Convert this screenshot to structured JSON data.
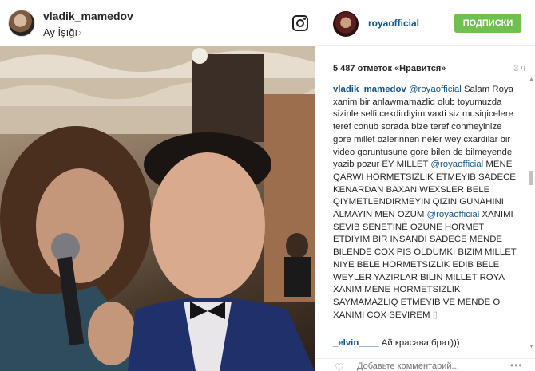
{
  "post": {
    "username": "vladik_mamedov",
    "location": "Ay İşığı",
    "location_chevron": "›"
  },
  "sidebar": {
    "account": "royaofficial",
    "follow_label": "ПОДПИСКИ",
    "likes": "5 487 отметок «Нравится»",
    "time": "3 ч"
  },
  "caption": {
    "user": "vladik_mamedov",
    "mention_1": "@royaofficial",
    "text_1": " Salam Roya xanim bir anlawmamazliq olub toyumuzda sizinle selfi cekdirdiyim vaxti siz musiqicelere teref conub sorada bize teref conmeyinize gore millet ozlerinnen neler wey cxardilar bir video goruntusune gore bilen de bilmeyende yazib pozur EY MILLET ",
    "mention_2": "@royaofficial",
    "text_2": " MENE QARWI HORMETSIZLIK ETMEYIB SADECE KENARDAN BAXAN WEXSLER BELE QIYMETLENDIRMEYIN QIZIN GUNAHINI ALMAYIN MEN OZUM ",
    "mention_3": "@royaofficial",
    "text_3": " XANIMI SEVIB SENETINE OZUNE HORMET ETDIYIM BIR INSANDI SADECE MENDE BILENDE COX PIS OLDUMKI BIZIM MILLET NIYE BELE HORMETSIZLIK EDIB BELE WEYLER YAZIRLAR BILIN MILLET ROYA XANIM MENE HORMETSIZLIK SAYMAMAZLIQ ETMEYIB VE MENDE O XANIMI COX SEVIREM ",
    "trailing_emoji": "▯"
  },
  "comment": {
    "user": "_elvin____",
    "text": " Ай красава брат)))"
  },
  "footer": {
    "heart": "♡",
    "placeholder": "Добавьте комментарий...",
    "more": "•••"
  },
  "scrollbar": {
    "up": "▲",
    "down": "▼"
  },
  "icons": {
    "left_header": "instagram-icon",
    "footer_like": "heart-icon",
    "footer_more": "more-icon"
  },
  "colors": {
    "link": "#125688",
    "follow_button": "#70c050",
    "muted": "#a5a7aa"
  }
}
